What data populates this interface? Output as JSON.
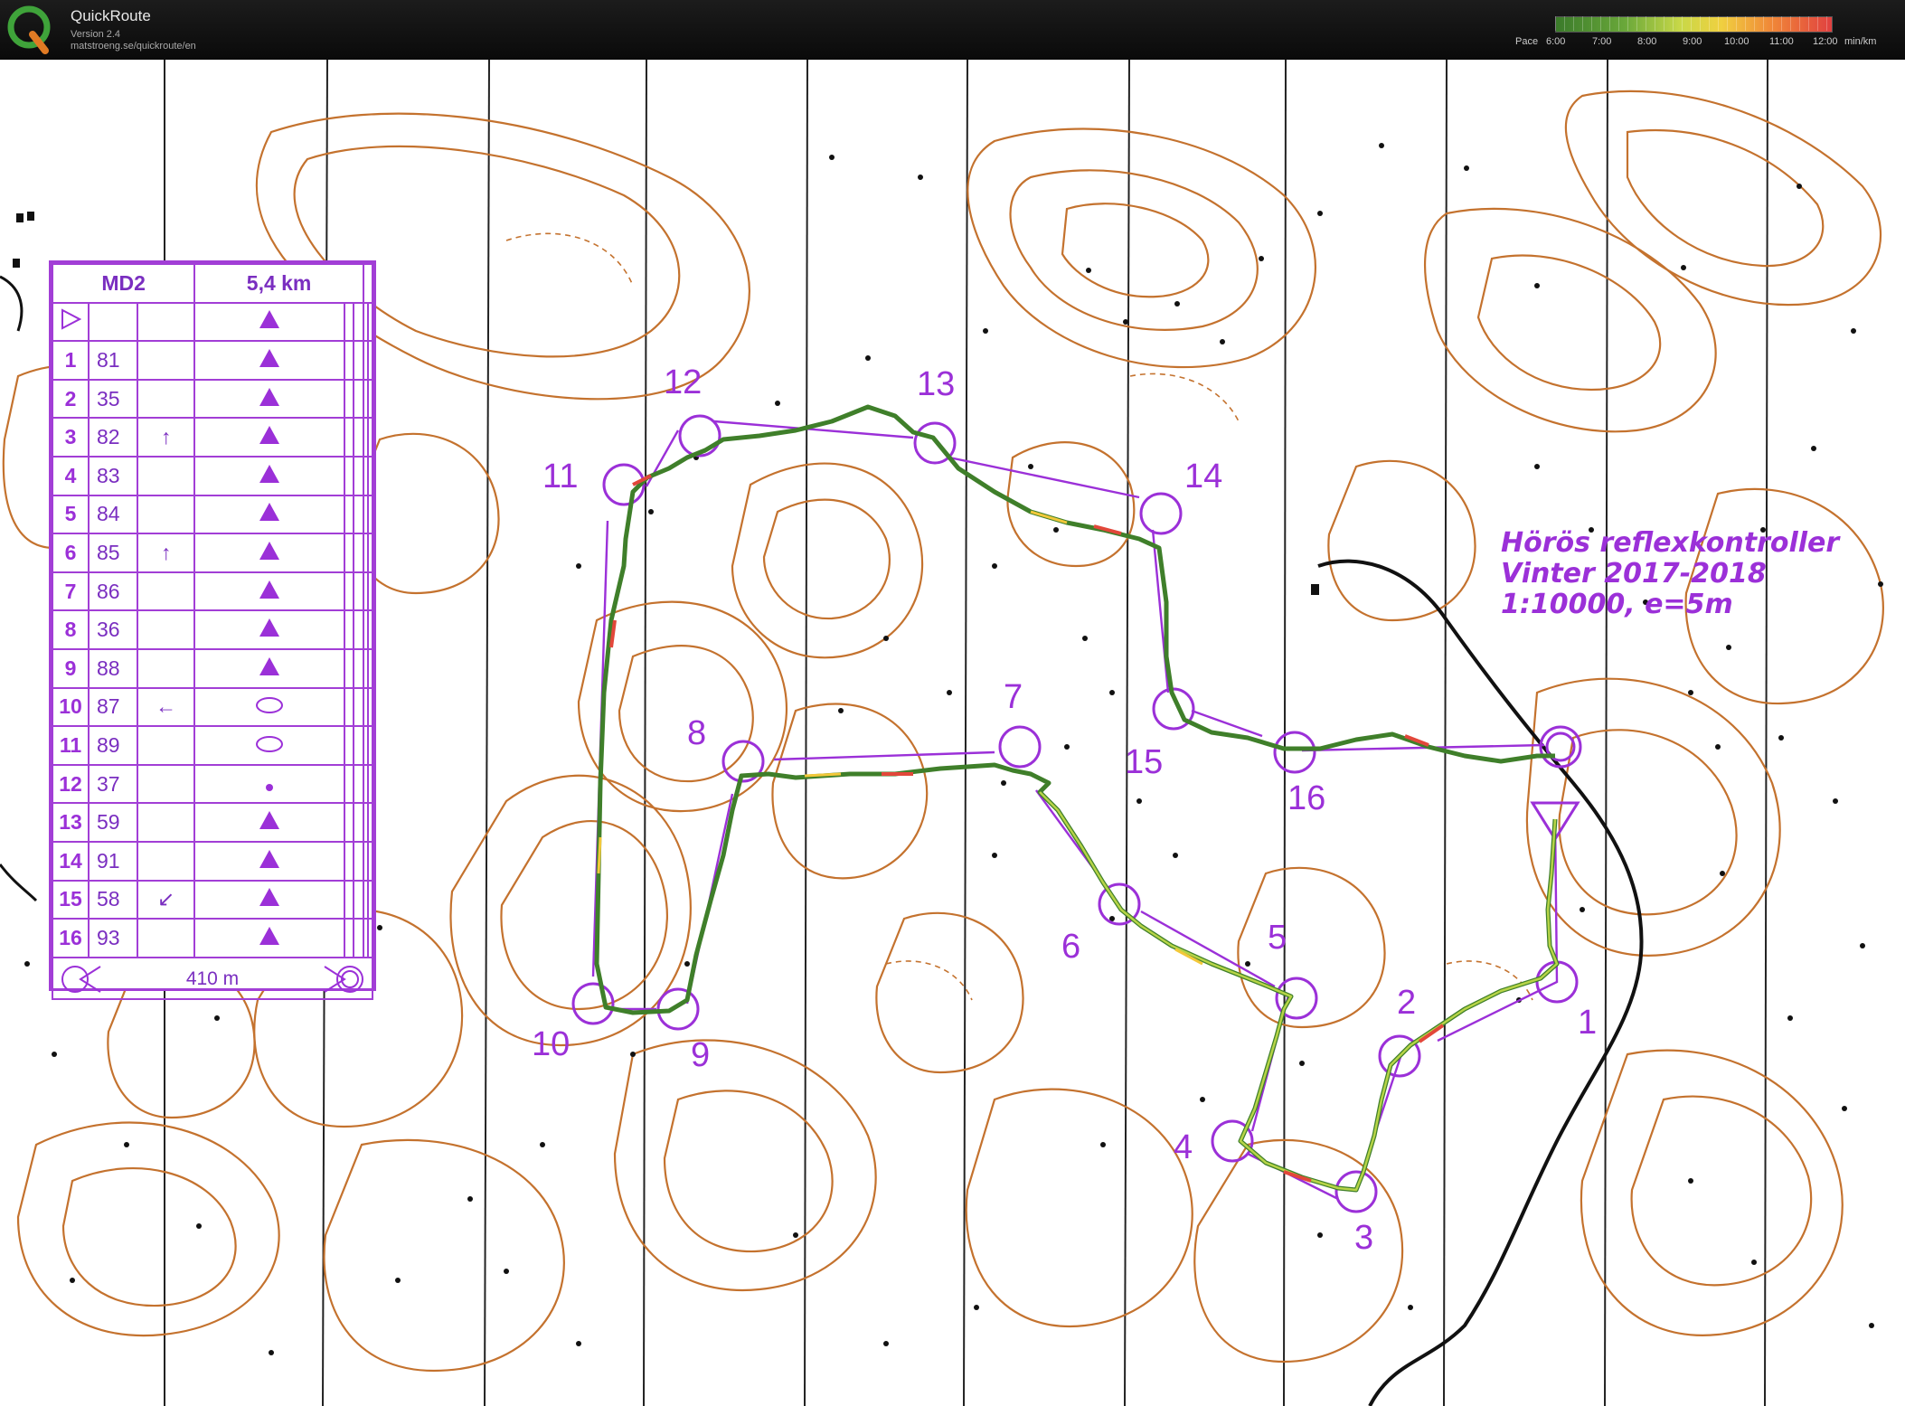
{
  "app": {
    "title": "QuickRoute",
    "version": "Version 2.4",
    "url": "matstroeng.se/quickroute/en"
  },
  "pace_scale": {
    "label": "Pace",
    "ticks": [
      "6:00",
      "7:00",
      "8:00",
      "9:00",
      "10:00",
      "11:00",
      "12:00"
    ],
    "unit": "min/km",
    "colors": [
      "#3a7a2a",
      "#6aa83a",
      "#c8d848",
      "#f0d040",
      "#f08838",
      "#e04040"
    ]
  },
  "legend": {
    "event": "MD2",
    "distance": "5,4 km",
    "rows": [
      {
        "num": "1",
        "code": "81",
        "dir": "",
        "sym": "tri"
      },
      {
        "num": "2",
        "code": "35",
        "dir": "",
        "sym": "tri"
      },
      {
        "num": "3",
        "code": "82",
        "dir": "↑",
        "sym": "tri"
      },
      {
        "num": "4",
        "code": "83",
        "dir": "",
        "sym": "tri"
      },
      {
        "num": "5",
        "code": "84",
        "dir": "",
        "sym": "tri"
      },
      {
        "num": "6",
        "code": "85",
        "dir": "↑",
        "sym": "tri"
      },
      {
        "num": "7",
        "code": "86",
        "dir": "",
        "sym": "tri"
      },
      {
        "num": "8",
        "code": "36",
        "dir": "",
        "sym": "tri"
      },
      {
        "num": "9",
        "code": "88",
        "dir": "",
        "sym": "tri"
      },
      {
        "num": "10",
        "code": "87",
        "dir": "←",
        "sym": "oval"
      },
      {
        "num": "11",
        "code": "89",
        "dir": "",
        "sym": "oval"
      },
      {
        "num": "12",
        "code": "37",
        "dir": "",
        "sym": "dot"
      },
      {
        "num": "13",
        "code": "59",
        "dir": "",
        "sym": "tri"
      },
      {
        "num": "14",
        "code": "91",
        "dir": "",
        "sym": "tri"
      },
      {
        "num": "15",
        "code": "58",
        "dir": "↙",
        "sym": "tri"
      },
      {
        "num": "16",
        "code": "93",
        "dir": "",
        "sym": "tri"
      }
    ],
    "finish_distance": "410 m"
  },
  "map": {
    "caption_lines": [
      "Hörös reflexkontroller",
      "Vinter 2017-2018",
      "1:10000, e=5m"
    ],
    "controls": [
      {
        "label": "1"
      },
      {
        "label": "2"
      },
      {
        "label": "3"
      },
      {
        "label": "4"
      },
      {
        "label": "5"
      },
      {
        "label": "6"
      },
      {
        "label": "7"
      },
      {
        "label": "8"
      },
      {
        "label": "9"
      },
      {
        "label": "10"
      },
      {
        "label": "11"
      },
      {
        "label": "12"
      },
      {
        "label": "13"
      },
      {
        "label": "14"
      },
      {
        "label": "15"
      },
      {
        "label": "16"
      }
    ],
    "colors": {
      "course": "#9b30d8",
      "contour": "#c4722e",
      "route": "#4f9a2c"
    }
  }
}
